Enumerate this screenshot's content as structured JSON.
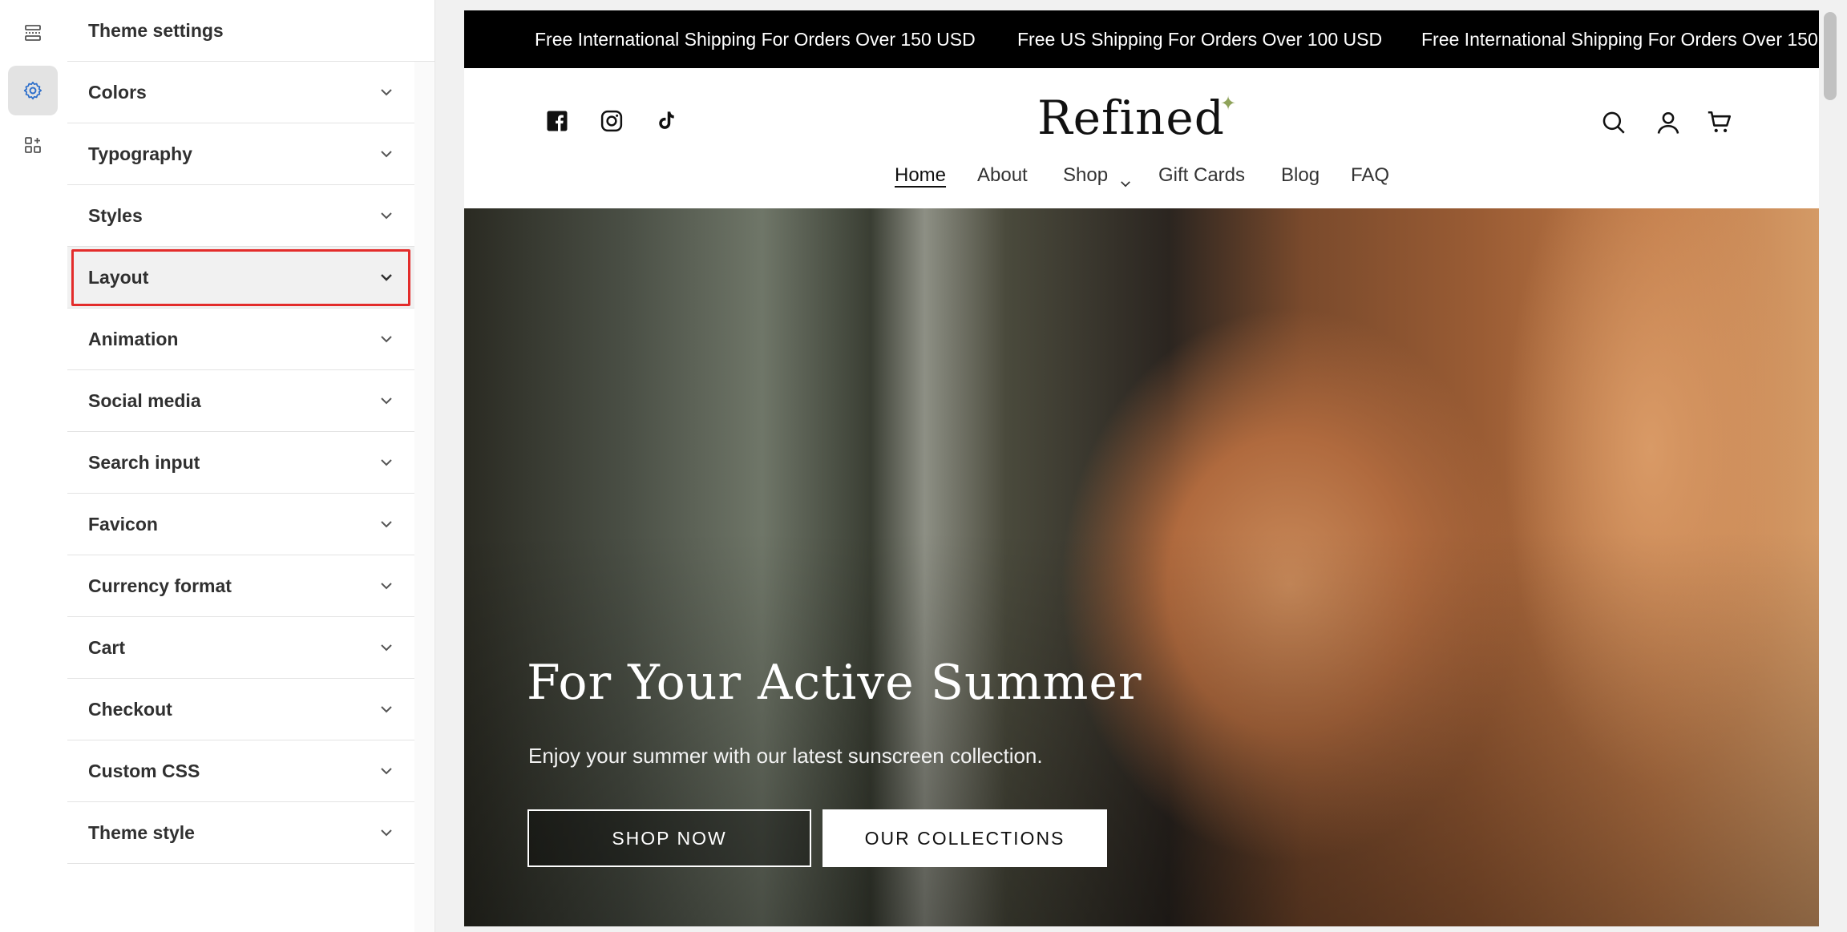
{
  "rail": {
    "items": [
      {
        "icon": "sections-icon"
      },
      {
        "icon": "gear-icon",
        "active": true
      },
      {
        "icon": "apps-icon"
      }
    ]
  },
  "panel": {
    "title": "Theme settings",
    "items": [
      {
        "label": "Colors"
      },
      {
        "label": "Typography"
      },
      {
        "label": "Styles"
      },
      {
        "label": "Layout",
        "selected": true
      },
      {
        "label": "Animation"
      },
      {
        "label": "Social media"
      },
      {
        "label": "Search input"
      },
      {
        "label": "Favicon"
      },
      {
        "label": "Currency format"
      },
      {
        "label": "Cart"
      },
      {
        "label": "Checkout"
      },
      {
        "label": "Custom CSS"
      },
      {
        "label": "Theme style"
      }
    ]
  },
  "preview": {
    "announcements": [
      "Free International Shipping For Orders Over 150 USD",
      "Free US Shipping For Orders Over 100 USD",
      "Free International Shipping For Orders Over 150"
    ],
    "logo": "Refined",
    "social_icons": [
      "facebook-icon",
      "instagram-icon",
      "tiktok-icon"
    ],
    "nav": [
      {
        "label": "Home",
        "active": true
      },
      {
        "label": "About"
      },
      {
        "label": "Shop"
      },
      {
        "label": "Gift Cards"
      },
      {
        "label": "Blog"
      },
      {
        "label": "FAQ"
      }
    ],
    "hero": {
      "title": "For Your Active Summer",
      "subtitle": "Enjoy your summer with our latest sunscreen collection.",
      "primary_button": "SHOP NOW",
      "secondary_button": "OUR COLLECTIONS"
    }
  },
  "colors": {
    "highlight": "#e32c2b",
    "announcement_bg": "#000000",
    "accent_sparkle": "#8fa35a"
  }
}
